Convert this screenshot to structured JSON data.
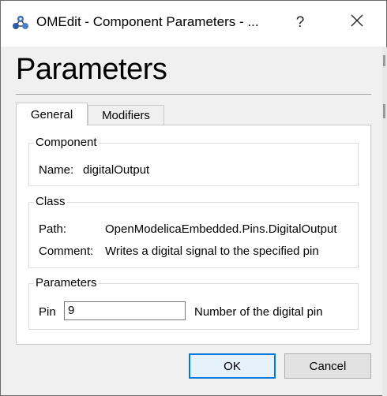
{
  "window": {
    "title": "OMEdit - Component Parameters - ..."
  },
  "title_buttons": {
    "help": "?",
    "close": "✕"
  },
  "header": {
    "title": "Parameters"
  },
  "tabs": [
    {
      "label": "General",
      "active": true
    },
    {
      "label": "Modifiers",
      "active": false
    }
  ],
  "component_group": {
    "legend": "Component",
    "name_label": "Name:",
    "name_value": "digitalOutput"
  },
  "class_group": {
    "legend": "Class",
    "path_label": "Path:",
    "path_value": "OpenModelicaEmbedded.Pins.DigitalOutput",
    "comment_label": "Comment:",
    "comment_value": "Writes a digital signal to the specified pin"
  },
  "parameters_group": {
    "legend": "Parameters",
    "pin_label": "Pin",
    "pin_value": "9",
    "pin_description": "Number of the digital pin"
  },
  "buttons": {
    "ok": "OK",
    "cancel": "Cancel"
  },
  "colors": {
    "accent": "#0078d7",
    "dialog_bg": "#f0f0f0",
    "panel_bg": "#ffffff",
    "ok_button_bg": "#e5f1fb"
  },
  "icons": {
    "app": "omedit-app-icon",
    "help": "help-icon",
    "close": "close-icon"
  }
}
